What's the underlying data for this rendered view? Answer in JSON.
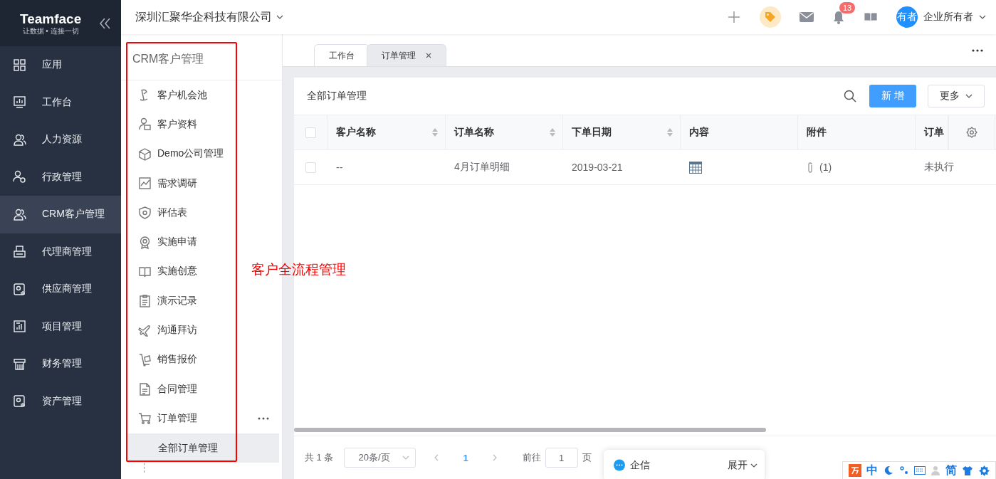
{
  "brand": {
    "name": "Teamface",
    "slogan": "让数据 • 连接一切"
  },
  "nav": [
    {
      "label": "应用",
      "selected": false
    },
    {
      "label": "工作台",
      "selected": false
    },
    {
      "label": "人力资源",
      "selected": false
    },
    {
      "label": "行政管理",
      "selected": false
    },
    {
      "label": "CRM客户管理",
      "selected": true
    },
    {
      "label": "代理商管理",
      "selected": false
    },
    {
      "label": "供应商管理",
      "selected": false
    },
    {
      "label": "项目管理",
      "selected": false
    },
    {
      "label": "财务管理",
      "selected": false
    },
    {
      "label": "资产管理",
      "selected": false
    }
  ],
  "header": {
    "company": "深圳汇聚华企科技有限公司",
    "notifications": "13",
    "avatar": "有者",
    "user": "企业所有者"
  },
  "module": {
    "title": "CRM客户管理",
    "items": [
      {
        "label": "客户机会池"
      },
      {
        "label": "客户资料"
      },
      {
        "label": "Demo公司管理"
      },
      {
        "label": "需求调研"
      },
      {
        "label": "评估表"
      },
      {
        "label": "实施申请"
      },
      {
        "label": "实施创意"
      },
      {
        "label": "演示记录"
      },
      {
        "label": "沟通拜访"
      },
      {
        "label": "销售报价"
      },
      {
        "label": "合同管理"
      },
      {
        "label": "订单管理",
        "children": [
          {
            "label": "全部订单管理",
            "selected": true
          }
        ]
      }
    ]
  },
  "tabs": [
    {
      "label": "工作台",
      "selected": false,
      "closable": false
    },
    {
      "label": "订单管理",
      "selected": true,
      "closable": true
    }
  ],
  "list": {
    "title": "全部订单管理",
    "add_button": "新 增",
    "more_button": "更多",
    "columns": [
      {
        "label": "客户名称",
        "sortable": true
      },
      {
        "label": "订单名称",
        "sortable": true
      },
      {
        "label": "下单日期",
        "sortable": true
      },
      {
        "label": "内容",
        "sortable": false
      },
      {
        "label": "附件",
        "sortable": false
      },
      {
        "label": "订单",
        "sortable": false
      }
    ],
    "header_checked": false,
    "rows": [
      {
        "checked": false,
        "cells": [
          {
            "kind": "text",
            "text": "--"
          },
          {
            "kind": "text",
            "text": "4月订单明细"
          },
          {
            "kind": "text",
            "text": "2019-03-21"
          },
          {
            "kind": "table"
          },
          {
            "kind": "attachment",
            "text": "(1)"
          },
          {
            "kind": "text",
            "text": "未执行"
          }
        ]
      }
    ]
  },
  "pagination": {
    "total": "共 1 条",
    "page_size": "20条/页",
    "pages": [
      {
        "label": "1",
        "selected": true
      }
    ],
    "goto_label": "前往",
    "goto_value": "1",
    "page_suffix": "页"
  },
  "chat": {
    "title": "企信",
    "toggle": "展开"
  },
  "ime": {
    "lang": "中",
    "script": "简"
  },
  "annotation": {
    "text": "客户全流程管理"
  }
}
